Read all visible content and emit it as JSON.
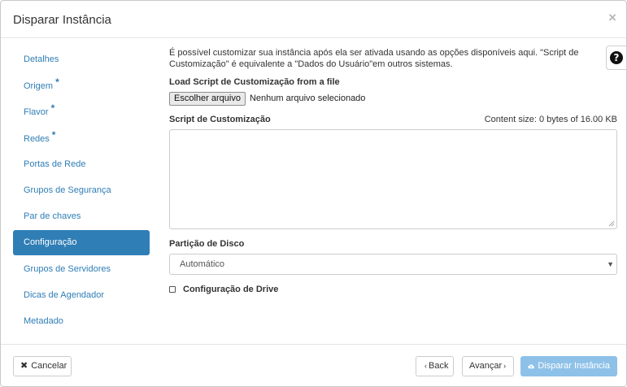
{
  "modal": {
    "title": "Disparar Instância",
    "close_label": "×"
  },
  "sidebar": {
    "items": [
      {
        "label": "Detalhes",
        "required": false,
        "active": false
      },
      {
        "label": "Origem",
        "required": true,
        "active": false
      },
      {
        "label": "Flavor",
        "required": true,
        "active": false
      },
      {
        "label": "Redes",
        "required": true,
        "active": false
      },
      {
        "label": "Portas de Rede",
        "required": false,
        "active": false
      },
      {
        "label": "Grupos de Segurança",
        "required": false,
        "active": false
      },
      {
        "label": "Par de chaves",
        "required": false,
        "active": false
      },
      {
        "label": "Configuração",
        "required": false,
        "active": true
      },
      {
        "label": "Grupos de Servidores",
        "required": false,
        "active": false
      },
      {
        "label": "Dicas de Agendador",
        "required": false,
        "active": false
      },
      {
        "label": "Metadado",
        "required": false,
        "active": false
      }
    ],
    "required_marker": "*"
  },
  "help": {
    "text": "É possível customizar sua instância após ela ser ativada usando as opções disponíveis aqui. \"Script de Customização\" é equivalente a \"Dados do Usuário\"em outros sistemas.",
    "button_label": "?"
  },
  "load_script": {
    "label": "Load Script de Customização from a file",
    "button_label": "Escolher arquivo",
    "file_name": "Nenhum arquivo selecionado"
  },
  "script": {
    "label": "Script de Customização",
    "content_size": "Content size: 0 bytes of 16.00 KB",
    "value": ""
  },
  "disk_partition": {
    "label": "Partição de Disco",
    "selected": "Automático"
  },
  "config_drive": {
    "label": "Configuração de Drive",
    "checked": false
  },
  "footer": {
    "cancel_label": "Cancelar",
    "back_label": "Back",
    "next_label": "Avançar",
    "launch_label": "Disparar Instância"
  },
  "colors": {
    "accent": "#2f7eb6",
    "launch_disabled": "#8ec1e8"
  }
}
